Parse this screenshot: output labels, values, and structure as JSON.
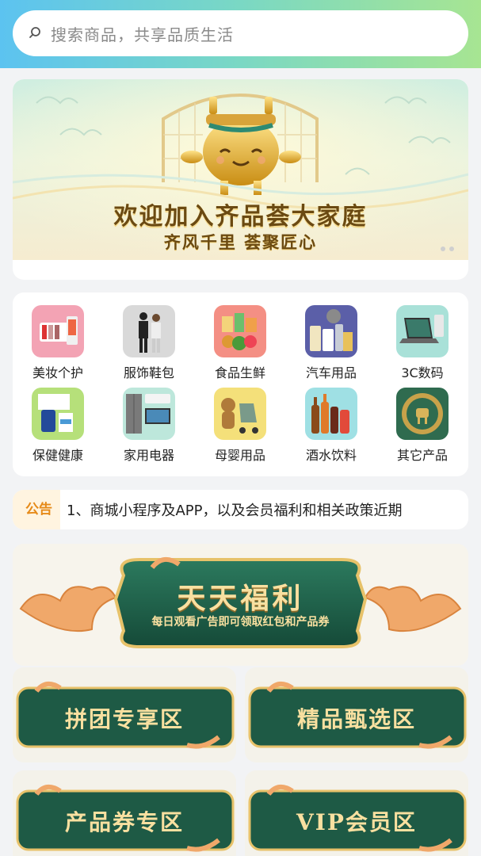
{
  "search": {
    "placeholder": "搜索商品，共享品质生活"
  },
  "banner": {
    "title": "欢迎加入齐品荟大家庭",
    "subtitle": "齐风千里 荟聚匠心"
  },
  "categories": [
    {
      "label": "美妆个护"
    },
    {
      "label": "服饰鞋包"
    },
    {
      "label": "食品生鲜"
    },
    {
      "label": "汽车用品"
    },
    {
      "label": "3C数码"
    },
    {
      "label": "保健健康"
    },
    {
      "label": "家用电器"
    },
    {
      "label": "母婴用品"
    },
    {
      "label": "酒水饮料"
    },
    {
      "label": "其它产品"
    }
  ],
  "notice": {
    "tag": "公告",
    "text": "1、商城小程序及APP，以及会员福利和相关政策近期"
  },
  "welfare": {
    "title": "天天福利",
    "subtitle": "每日观看广告即可领取红包和产品券"
  },
  "zones": [
    {
      "label": "拼团专享区"
    },
    {
      "label": "精品甄选区"
    },
    {
      "label": "产品券专区"
    },
    {
      "label": "VIP会员区"
    }
  ],
  "colors": {
    "accent_green": "#1e5a45",
    "gold": "#e7c26a",
    "notice_orange": "#e68a18"
  }
}
